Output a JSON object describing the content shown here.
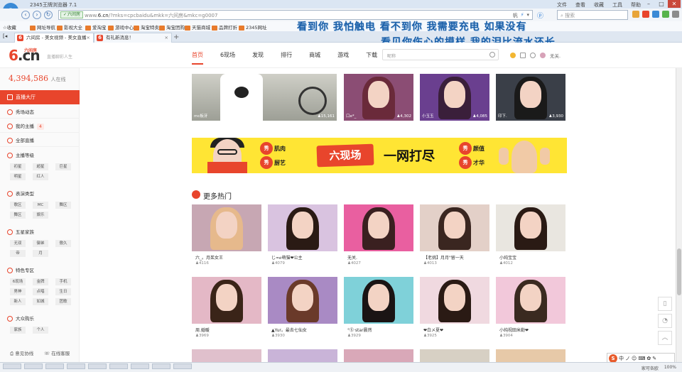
{
  "browser": {
    "window_title": "2345王牌浏览器 7.1",
    "menu": [
      "文件",
      "查看",
      "收藏",
      "工具",
      "帮助"
    ],
    "secure_label": "六间房",
    "url_grey_prefix": "www.",
    "url_domain": "6.cn",
    "url_rest": "/?mks=cpcbaidu&mkk=六间房&mkc=g0007",
    "search_placeholder": "搜索",
    "addr_right_label": "帆",
    "bookmarks": [
      "收藏",
      "网址导航",
      "影视大全",
      "爱淘宝",
      "游戏中心",
      "淘宝特卖",
      "淘宝团购",
      "天猫商城",
      "品牌打折",
      "2345网址"
    ],
    "tabs": [
      {
        "label": "六间房 - 美女视频 - 美女直播",
        "active": true
      },
      {
        "label": "有礼新消息！",
        "active": false
      }
    ],
    "new_tab": "+"
  },
  "lyrics": {
    "line1": "看到你  我怕触电  看不到你  我需要充电  如果没有",
    "line2": "看见你伤心的摸样  我的泪比流水还长"
  },
  "site": {
    "logo_six": "6",
    "logo_cn": ".cn",
    "logo_sub": "六间房",
    "slogan": "直播聊彩人生",
    "nav": [
      {
        "label": "首页",
        "active": true
      },
      {
        "label": "6现场",
        "active": false
      },
      {
        "label": "发现",
        "active": false
      },
      {
        "label": "排行",
        "active": false
      },
      {
        "label": "商城",
        "active": false
      },
      {
        "label": "游戏",
        "active": false
      },
      {
        "label": "下载",
        "active": false
      }
    ],
    "search_placeholder": "昵称",
    "user_name": "无关."
  },
  "sidebar": {
    "online_count": "4,394,586",
    "online_label": "人在线",
    "hot_label": "直播大厅",
    "items": [
      {
        "label": "秀场动态",
        "badge": ""
      },
      {
        "label": "我的主播",
        "badge": "4"
      },
      {
        "label": "全部直播",
        "badge": ""
      }
    ],
    "groups": [
      {
        "title": "主播等级",
        "tags": [
          "初星",
          "超星",
          "巨星",
          "明星",
          "红人"
        ]
      },
      {
        "title": "表演类型",
        "tags": [
          "歌区",
          "MC",
          "舞区",
          "舞区",
          "娱乐"
        ]
      },
      {
        "title": "五星家族",
        "tags": [
          "无双",
          "御弟",
          "傲久",
          "帝",
          "月"
        ]
      },
      {
        "title": "特色专区",
        "tags": [
          "6现场",
          "金牌",
          "手机",
          "男神",
          "点唱",
          "生日",
          "新人",
          "如城",
          "团歌"
        ]
      },
      {
        "title": "大众购乐",
        "tags": [
          "家族",
          "个人"
        ]
      }
    ],
    "footer": [
      "意见协线",
      "在线客服"
    ]
  },
  "top_row": [
    {
      "name": "mc板牙",
      "count": "15,161"
    },
    {
      "name": "口e*_",
      "count": "4,302"
    },
    {
      "name": "小玉玉",
      "count": "4,085"
    },
    {
      "name": "印下.",
      "count": "3,930"
    }
  ],
  "banner": {
    "tags_left": [
      "秀",
      "肌肉",
      "秀",
      "厨艺"
    ],
    "brand": "六现场",
    "slogan": "一网打尽",
    "tags_right": [
      "秀",
      "颜值",
      "秀",
      "才华"
    ]
  },
  "section": {
    "title": "更多热门"
  },
  "cards": [
    {
      "title": "六_。月茱女王",
      "count": "4116"
    },
    {
      "title": "じ≈ℯ萌猫❤公主",
      "count": "4079"
    },
    {
      "title": "无关.",
      "count": "4027"
    },
    {
      "title": "【老挑】月月\"留一天",
      "count": "4013"
    },
    {
      "title": "小纯宝宝",
      "count": "4012"
    },
    {
      "title": "周.婚暖",
      "count": "3969"
    },
    {
      "title": "▲Yur。最去七仙女",
      "count": "3930"
    },
    {
      "title": "°Ⓢ·star晨然",
      "count": "3929"
    },
    {
      "title": "❤白メ夏❤",
      "count": "3925"
    },
    {
      "title": "小纯视田米勒❤",
      "count": "3904"
    }
  ],
  "statusbar": {
    "items": [
      "家可各欧",
      "100%"
    ]
  },
  "colors": {
    "accent": "#e8452c",
    "lyric": "#1a5fa8",
    "banner": "#ffe534"
  }
}
